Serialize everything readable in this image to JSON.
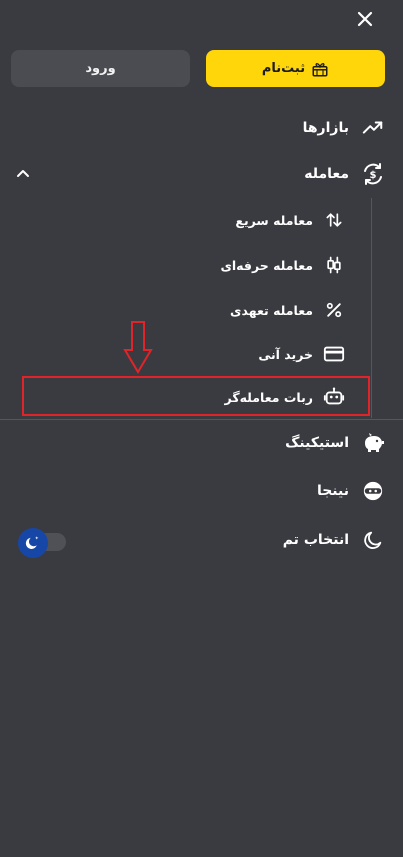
{
  "header": {
    "close_icon": "close-icon"
  },
  "auth": {
    "login_label": "ورود",
    "signup_label": "ثبت‌نام",
    "signup_icon": "gift-icon",
    "accent_color": "#ffd60a"
  },
  "menu": {
    "markets": {
      "label": "بازارها",
      "icon": "trending-up-icon"
    },
    "trade": {
      "label": "معامله",
      "icon": "currency-exchange-icon",
      "expanded": true,
      "sub_items": [
        {
          "label": "معامله سریع",
          "icon": "swap-vertical-icon"
        },
        {
          "label": "معامله حرفه‌ای",
          "icon": "candlestick-icon"
        },
        {
          "label": "معامله تعهدی",
          "icon": "percent-icon"
        },
        {
          "label": "خرید آنی",
          "icon": "card-icon"
        },
        {
          "label": "ربات معامله‌گر",
          "icon": "robot-icon"
        }
      ]
    },
    "staking": {
      "label": "استیکینگ",
      "icon": "piggy-bank-icon"
    },
    "ninja": {
      "label": "نینجا",
      "icon": "ninja-icon"
    },
    "theme": {
      "label": "انتخاب تم",
      "icon": "moon-icon",
      "dark_mode": true
    }
  },
  "annotation": {
    "highlight_color": "#e0242a"
  }
}
